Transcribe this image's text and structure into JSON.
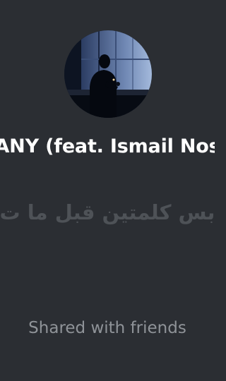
{
  "track": {
    "title": "ANY (feat. Ismail Nos",
    "lyric": "بس كلمتين قبل ما ت",
    "avatar_icon": "silhouette-by-window-photo"
  },
  "footer": {
    "shared_label": "Shared with friends"
  },
  "colors": {
    "background": "#2b2e33",
    "title": "#ffffff",
    "lyric": "#4e5257",
    "footer": "#8f9398"
  }
}
